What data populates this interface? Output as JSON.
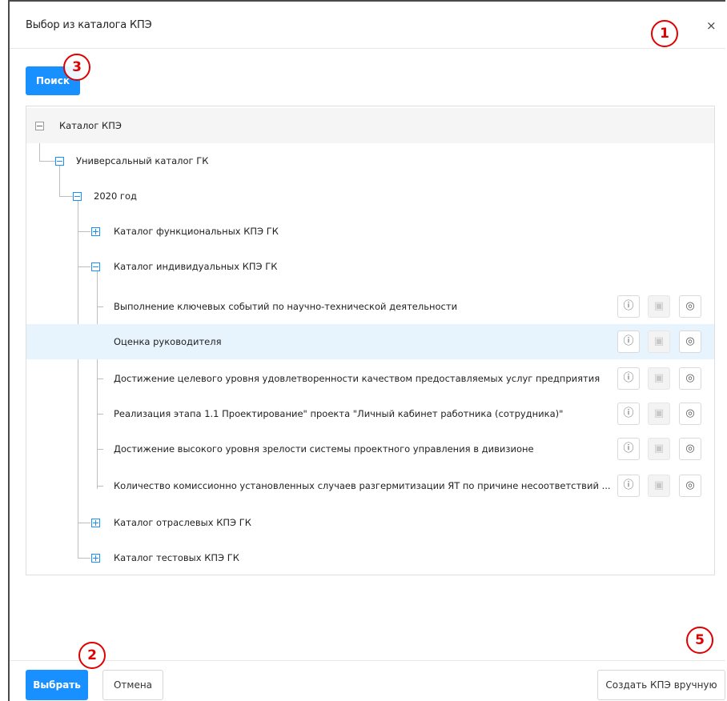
{
  "dialog": {
    "title": "Выбор из каталога КПЭ",
    "close_label": "×"
  },
  "search_button": "Поиск",
  "tree": {
    "root": "Каталог КПЭ",
    "universal": "Универсальный каталог ГК",
    "year": "2020 год",
    "functional": "Каталог функциональных КПЭ ГК",
    "individual": "Каталог индивидуальных КПЭ ГК",
    "items": [
      "Выполнение ключевых событий по научно-технической деятельности",
      "Оценка руководителя",
      "Достижение целевого уровня удовлетворенности качеством предоставляемых услуг предприятия",
      "Реализация этапа 1.1 Проектирование\" проекта \"Личный кабинет работника (сотрудника)\"",
      "Достижение высокого уровня зрелости системы проектного управления в дивизионе",
      "Количество комиссионно установленных случаев разгермитизации ЯТ по причине несоответствий ..."
    ],
    "industry": "Каталог отраслевых КПЭ ГК",
    "test": "Каталог тестовых КПЭ ГК"
  },
  "actions": {
    "info_icon": "ⓘ",
    "pdf_icon": "▣",
    "view_icon": "◎"
  },
  "footer": {
    "select_button": "Выбрать",
    "cancel_button": "Отмена",
    "create_button": "Создать КПЭ вручную"
  },
  "annotations": [
    "1",
    "2",
    "3",
    "5"
  ],
  "colors": {
    "primary": "#1890ff",
    "selected_row": "#e8f4fd",
    "annotation": "#e00000"
  }
}
